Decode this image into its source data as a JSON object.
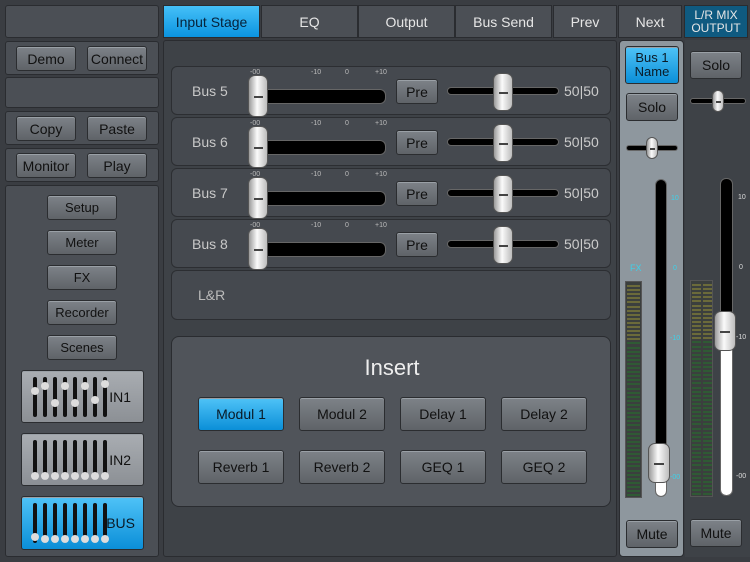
{
  "tabs": [
    {
      "label": "Input Stage",
      "active": true
    },
    {
      "label": "EQ"
    },
    {
      "label": "Output"
    },
    {
      "label": "Bus Send"
    },
    {
      "label": "Prev"
    },
    {
      "label": "Next"
    }
  ],
  "lr_header": "L/R MIX OUTPUT",
  "left": {
    "demo": "Demo",
    "connect": "Connect",
    "copy": "Copy",
    "paste": "Paste",
    "monitor": "Monitor",
    "play": "Play",
    "menu": [
      "Setup",
      "Meter",
      "FX",
      "Recorder",
      "Scenes"
    ],
    "banks": [
      {
        "label": "IN1"
      },
      {
        "label": "IN2"
      },
      {
        "label": "BUS",
        "active": true
      }
    ]
  },
  "scale": [
    "-00",
    "-10",
    "0",
    "+10"
  ],
  "buses": [
    {
      "label": "Bus 5",
      "pre": "Pre",
      "pan": "50|50",
      "level": 0,
      "pan_pos": 0.5
    },
    {
      "label": "Bus 6",
      "pre": "Pre",
      "pan": "50|50",
      "level": 0,
      "pan_pos": 0.5
    },
    {
      "label": "Bus 7",
      "pre": "Pre",
      "pan": "50|50",
      "level": 0,
      "pan_pos": 0.5
    },
    {
      "label": "Bus 8",
      "pre": "Pre",
      "pan": "50|50",
      "level": 0,
      "pan_pos": 0.5
    }
  ],
  "lr_row": "L&R",
  "insert": {
    "title": "Insert",
    "buttons": [
      {
        "label": "Modul 1",
        "active": true
      },
      {
        "label": "Modul 2"
      },
      {
        "label": "Delay 1"
      },
      {
        "label": "Delay 2"
      },
      {
        "label": "Reverb 1"
      },
      {
        "label": "Reverb 2"
      },
      {
        "label": "GEQ 1"
      },
      {
        "label": "GEQ 2"
      }
    ]
  },
  "strip": {
    "name": "Bus 1 Name",
    "solo": "Solo",
    "mute": "Mute",
    "fx": "FX",
    "ticks": [
      "10",
      "0",
      "-10",
      "-00"
    ],
    "fader_level": 0.05,
    "pan_pos": 0.5,
    "tick_color": "#3fd0e8"
  },
  "lr": {
    "solo": "Solo",
    "mute": "Mute",
    "ticks": [
      "10",
      "0",
      "-10",
      "-00"
    ],
    "fader_level": 0.52,
    "pan_pos": 0.5
  },
  "accent": "#1ea7f0"
}
